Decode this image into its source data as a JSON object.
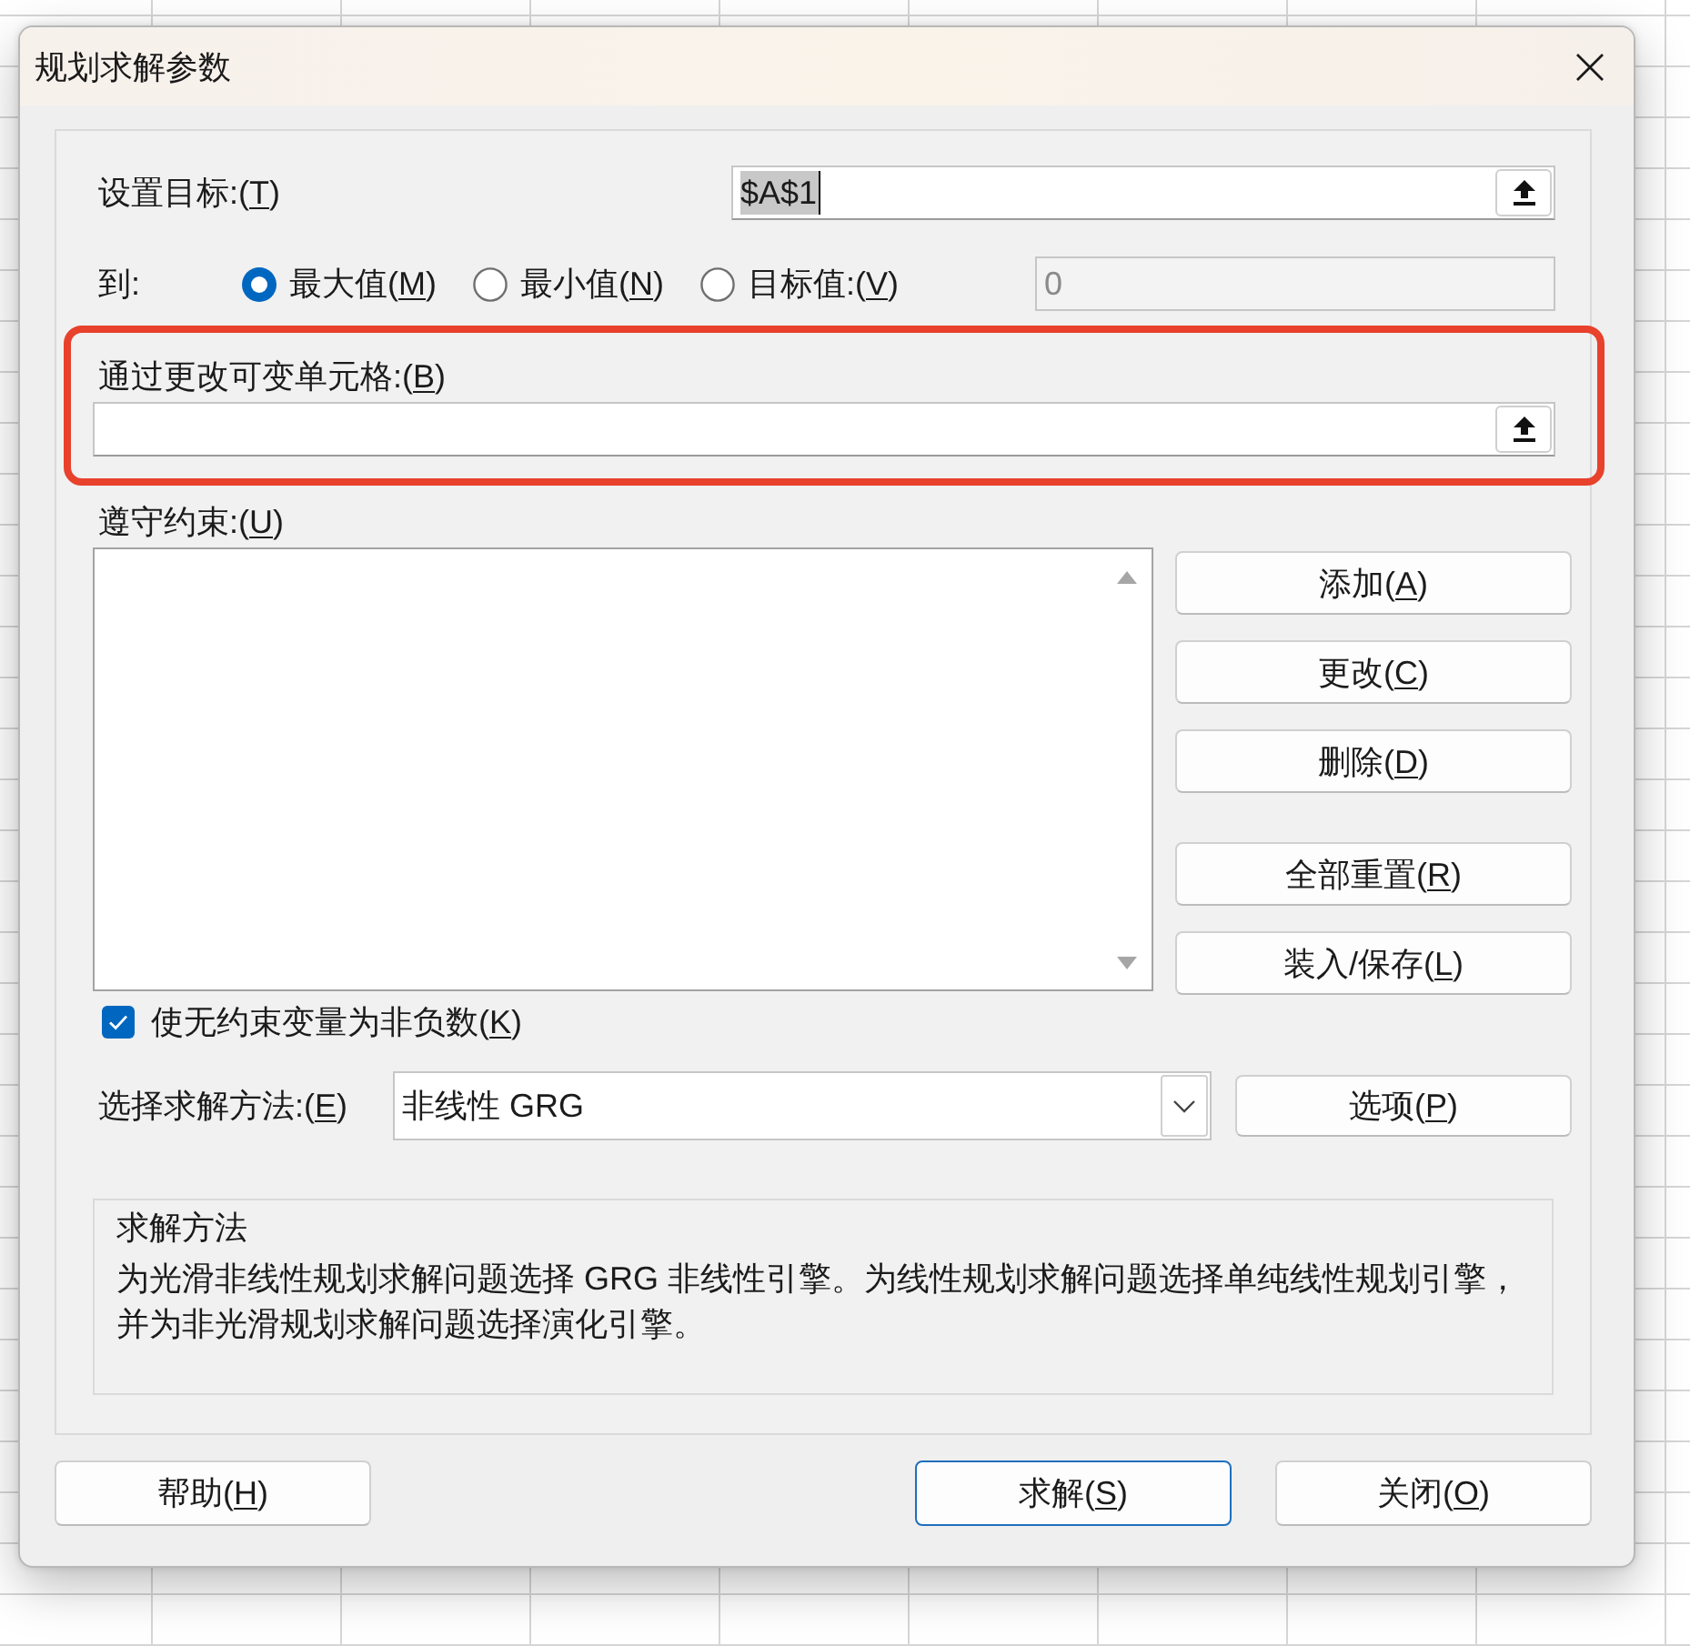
{
  "window": {
    "title": "规划求解参数"
  },
  "objective": {
    "label": "设置目标:(T)",
    "value": "$A$1",
    "text_selected": true
  },
  "to": {
    "label": "到:",
    "options": [
      {
        "label": "最大值(M)",
        "selected": true
      },
      {
        "label": "最小值(N)",
        "selected": false
      },
      {
        "label": "目标值:(V)",
        "selected": false
      }
    ],
    "value_field": {
      "value": "0",
      "disabled": true
    }
  },
  "changing_cells": {
    "label": "通过更改可变单元格:(B)",
    "highlighted": true
  },
  "constraints": {
    "label": "遵守约束:(U)",
    "button_groups": [
      [
        "添加(A)",
        "更改(C)",
        "删除(D)"
      ],
      [
        "全部重置(R)",
        "装入/保存(L)"
      ]
    ]
  },
  "non_negative": {
    "label": "使无约束变量为非负数(K)",
    "checked": true
  },
  "solving_method": {
    "label": "选择求解方法:(E)",
    "value": "非线性 GRG",
    "options_button": "选项(P)"
  },
  "method_description": {
    "title": "求解方法",
    "text": "为光滑非线性规划求解问题选择 GRG 非线性引擎。为线性规划求解问题选择单纯线性规划引擎，并为非光滑规划求解问题选择演化引擎。"
  },
  "footer": {
    "left_buttons": [
      {
        "label": "帮助(H)",
        "is_default": false
      }
    ],
    "right_buttons": [
      {
        "label": "求解(S)",
        "is_default": true
      },
      {
        "label": "关闭(O)",
        "is_default": false
      }
    ]
  }
}
